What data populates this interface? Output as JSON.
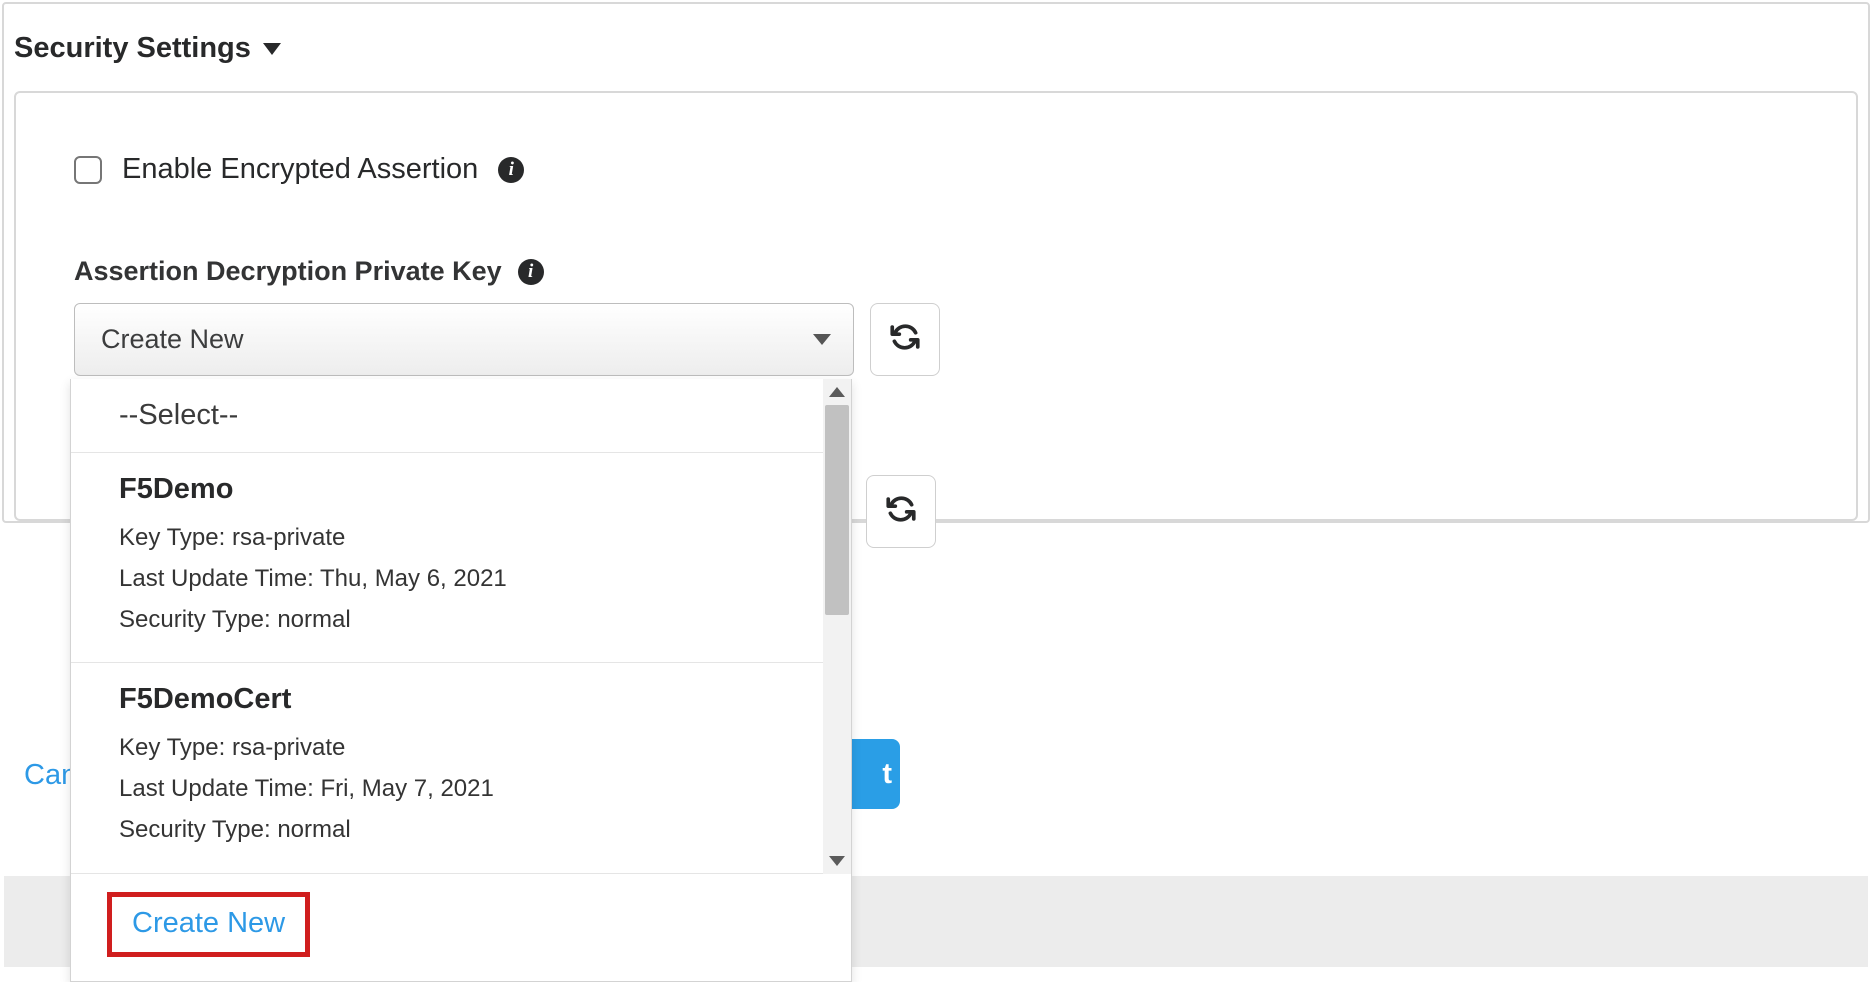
{
  "section_title": "Security Settings",
  "enable_encrypted_label": "Enable Encrypted Assertion",
  "field_label": "Assertion Decryption Private Key",
  "select_current": "Create New",
  "dropdown": {
    "placeholder": "--Select--",
    "options": [
      {
        "name": "F5Demo",
        "key_type_label": "Key Type:",
        "key_type": "rsa-private",
        "last_update_label": "Last Update Time:",
        "last_update": "Thu, May 6, 2021",
        "security_type_label": "Security Type:",
        "security_type": "normal"
      },
      {
        "name": "F5DemoCert",
        "key_type_label": "Key Type:",
        "key_type": "rsa-private",
        "last_update_label": "Last Update Time:",
        "last_update": "Fri, May 7, 2021",
        "security_type_label": "Security Type:",
        "security_type": "normal"
      }
    ],
    "create_new": "Create New"
  },
  "footer": {
    "cancel_prefix": "Can",
    "next_suffix": "t"
  }
}
